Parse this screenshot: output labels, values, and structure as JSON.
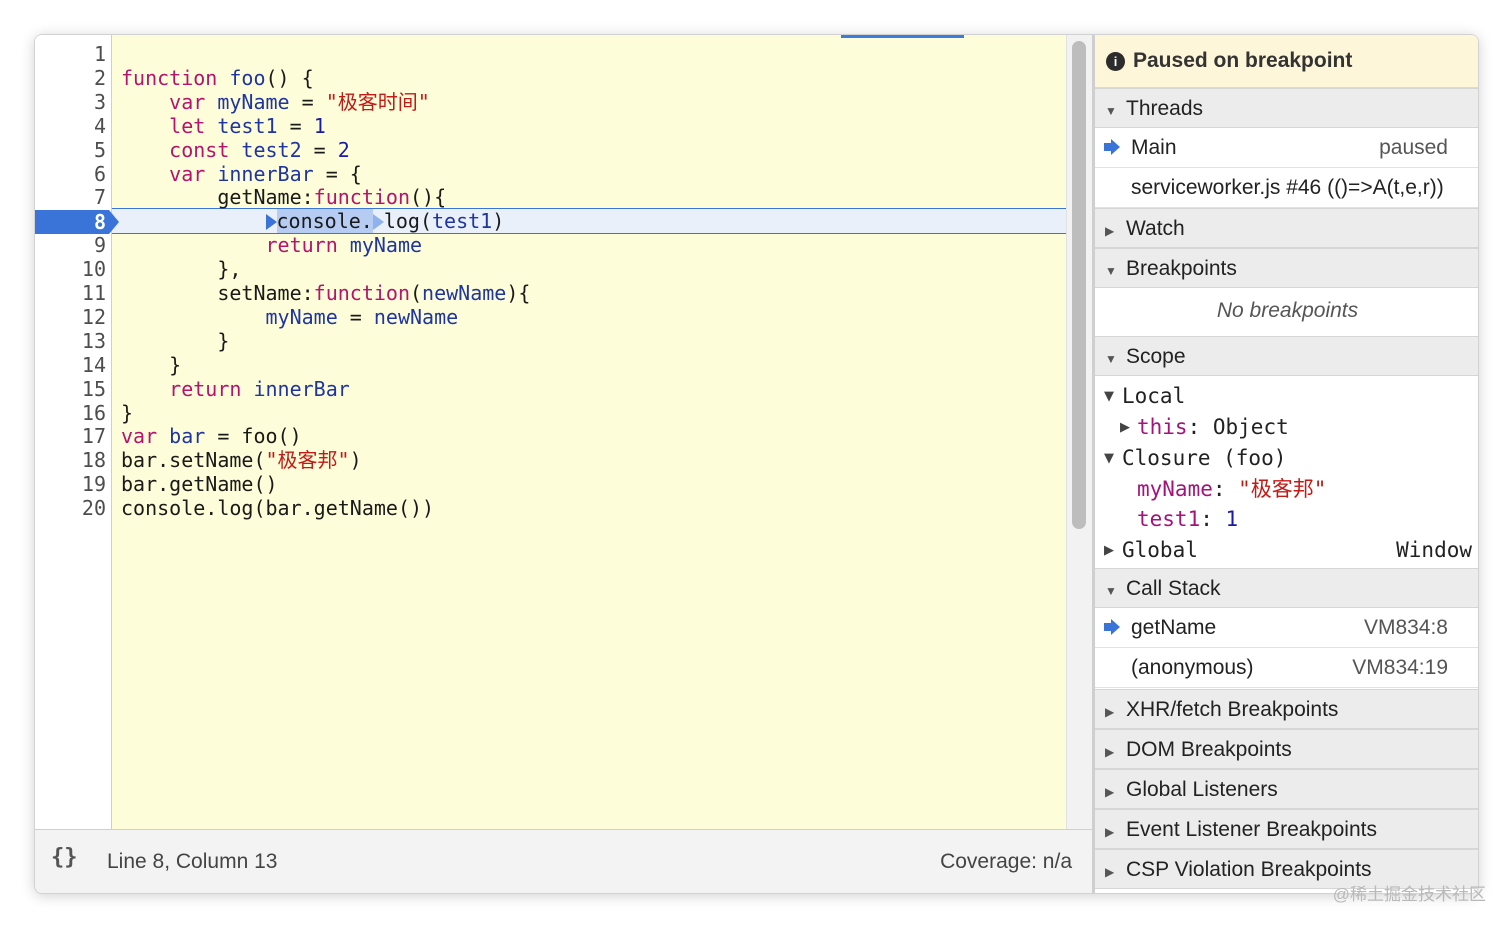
{
  "editor": {
    "line_numbers": [
      "1",
      "2",
      "3",
      "4",
      "5",
      "6",
      "7",
      "8",
      "9",
      "10",
      "11",
      "12",
      "13",
      "14",
      "15",
      "16",
      "17",
      "18",
      "19",
      "20"
    ],
    "current_line": "8",
    "lines": [
      {
        "n": 2,
        "seg": [
          [
            "kw",
            "function "
          ],
          [
            "df",
            "foo"
          ],
          [
            "",
            "() {"
          ]
        ]
      },
      {
        "n": 3,
        "seg": [
          [
            "",
            "    "
          ],
          [
            "kw",
            "var "
          ],
          [
            "df",
            "myName"
          ],
          [
            "",
            " = "
          ],
          [
            "st",
            "\"极客时间\""
          ]
        ]
      },
      {
        "n": 4,
        "seg": [
          [
            "",
            "    "
          ],
          [
            "kw",
            "let "
          ],
          [
            "df",
            "test1"
          ],
          [
            "",
            " = "
          ],
          [
            "nm",
            "1"
          ]
        ]
      },
      {
        "n": 5,
        "seg": [
          [
            "",
            "    "
          ],
          [
            "kw",
            "const "
          ],
          [
            "df",
            "test2"
          ],
          [
            "",
            " = "
          ],
          [
            "nm",
            "2"
          ]
        ]
      },
      {
        "n": 6,
        "seg": [
          [
            "",
            "    "
          ],
          [
            "kw",
            "var "
          ],
          [
            "df",
            "innerBar"
          ],
          [
            "",
            " = {"
          ]
        ]
      },
      {
        "n": 7,
        "seg": [
          [
            "",
            "        getName:"
          ],
          [
            "kw",
            "function"
          ],
          [
            "",
            "(){"
          ]
        ]
      },
      {
        "n": 8,
        "seg": [
          [
            "",
            "            "
          ],
          [
            "tri",
            ""
          ],
          [
            "hl",
            "console."
          ],
          [
            "trih",
            ""
          ],
          [
            "",
            "log("
          ],
          [
            "df",
            "test1"
          ],
          [
            "",
            ")"
          ]
        ]
      },
      {
        "n": 9,
        "seg": [
          [
            "",
            "            "
          ],
          [
            "kw",
            "return "
          ],
          [
            "df",
            "myName"
          ]
        ]
      },
      {
        "n": 10,
        "seg": [
          [
            "",
            "        },"
          ]
        ]
      },
      {
        "n": 11,
        "seg": [
          [
            "",
            "        setName:"
          ],
          [
            "kw",
            "function"
          ],
          [
            "",
            "("
          ],
          [
            "df",
            "newName"
          ],
          [
            "",
            "){"
          ]
        ]
      },
      {
        "n": 12,
        "seg": [
          [
            "",
            "            "
          ],
          [
            "df",
            "myName"
          ],
          [
            "",
            " = "
          ],
          [
            "df",
            "newName"
          ]
        ]
      },
      {
        "n": 13,
        "seg": [
          [
            "",
            "        }"
          ]
        ]
      },
      {
        "n": 14,
        "seg": [
          [
            "",
            "    }"
          ]
        ]
      },
      {
        "n": 15,
        "seg": [
          [
            "",
            "    "
          ],
          [
            "kw",
            "return "
          ],
          [
            "df",
            "innerBar"
          ]
        ]
      },
      {
        "n": 16,
        "seg": [
          [
            "",
            "}"
          ]
        ]
      },
      {
        "n": 17,
        "seg": [
          [
            "kw",
            "var "
          ],
          [
            "df",
            "bar"
          ],
          [
            "",
            " = foo()"
          ]
        ]
      },
      {
        "n": 18,
        "seg": [
          [
            "",
            "bar.setName("
          ],
          [
            "st",
            "\"极客邦\""
          ],
          [
            "",
            ")"
          ]
        ]
      },
      {
        "n": 19,
        "seg": [
          [
            "",
            "bar.getName()"
          ]
        ]
      },
      {
        "n": 20,
        "seg": [
          [
            "",
            "console.log(bar.getName())"
          ]
        ]
      }
    ]
  },
  "statusbar": {
    "pretty_print": "{}",
    "position": "Line 8, Column 13",
    "coverage": "Coverage: n/a"
  },
  "sidebar": {
    "paused_title": "Paused on breakpoint",
    "threads": {
      "label": "Threads",
      "items": [
        {
          "name": "Main",
          "state": "paused"
        },
        {
          "name": "serviceworker.js #46 (()=>A(t,e,r))",
          "state": ""
        }
      ]
    },
    "watch": {
      "label": "Watch"
    },
    "breakpoints": {
      "label": "Breakpoints",
      "empty": "No breakpoints"
    },
    "scope": {
      "label": "Scope",
      "local": "Local",
      "this_key": "this",
      "this_val": "Object",
      "closure": "Closure (foo)",
      "myName_key": "myName",
      "myName_val": "\"极客邦\"",
      "test1_key": "test1",
      "test1_val": "1",
      "global": "Global",
      "global_val": "Window"
    },
    "call_stack": {
      "label": "Call Stack",
      "frames": [
        {
          "name": "getName",
          "loc": "VM834:8"
        },
        {
          "name": "(anonymous)",
          "loc": "VM834:19"
        }
      ]
    },
    "xhr": "XHR/fetch Breakpoints",
    "dom": "DOM Breakpoints",
    "global_listeners": "Global Listeners",
    "event_listener": "Event Listener Breakpoints",
    "csp": "CSP Violation Breakpoints"
  },
  "watermark": "@稀土掘金技术社区",
  "colors": {
    "keyword": "#b4136e",
    "definition": "#1f35a0",
    "string": "#c41a16",
    "number": "#1a1aa6",
    "exec_blue": "#3b74d8",
    "editor_bg": "#fefdd9"
  }
}
